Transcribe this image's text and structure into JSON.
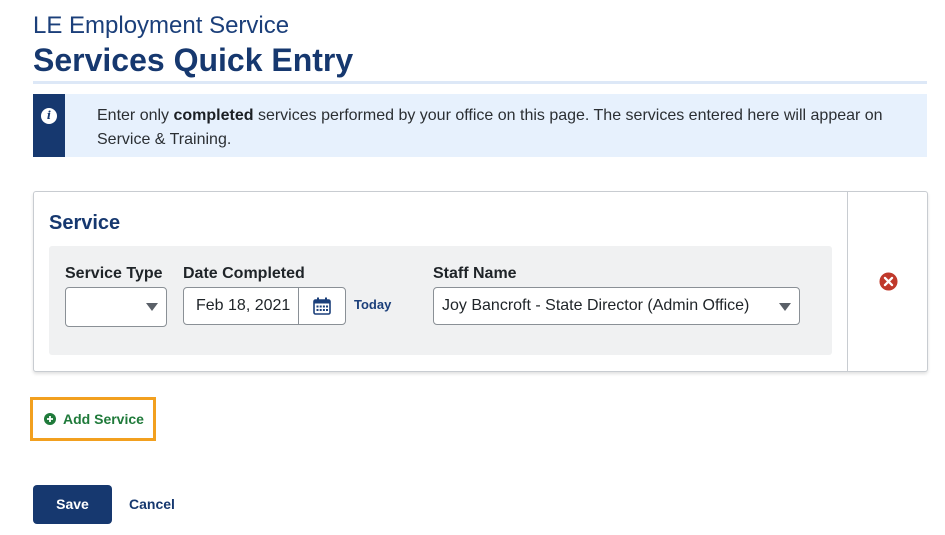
{
  "header": {
    "subtitle": "LE Employment Service",
    "title": "Services Quick Entry"
  },
  "info": {
    "icon": "info-icon",
    "text_before": "Enter only ",
    "text_bold": "completed",
    "text_after": " services performed by your office on this page. The services entered here will appear on Service & Training."
  },
  "service_card": {
    "heading": "Service",
    "service_type": {
      "label": "Service Type",
      "value": ""
    },
    "date_completed": {
      "label": "Date Completed",
      "value": "Feb 18, 2021",
      "calendar_icon": "calendar-icon",
      "today_label": "Today"
    },
    "staff_name": {
      "label": "Staff Name",
      "value": "Joy Bancroft - State Director (Admin Office)"
    },
    "remove_icon": "close-circle-icon"
  },
  "actions": {
    "add_service_label": "Add Service",
    "save_label": "Save",
    "cancel_label": "Cancel"
  },
  "colors": {
    "primary": "#16386f",
    "info_bg": "#e7f1fd",
    "add_green": "#1f7a3a",
    "focus_orange": "#f2a01f",
    "remove_red": "#c0392b"
  }
}
